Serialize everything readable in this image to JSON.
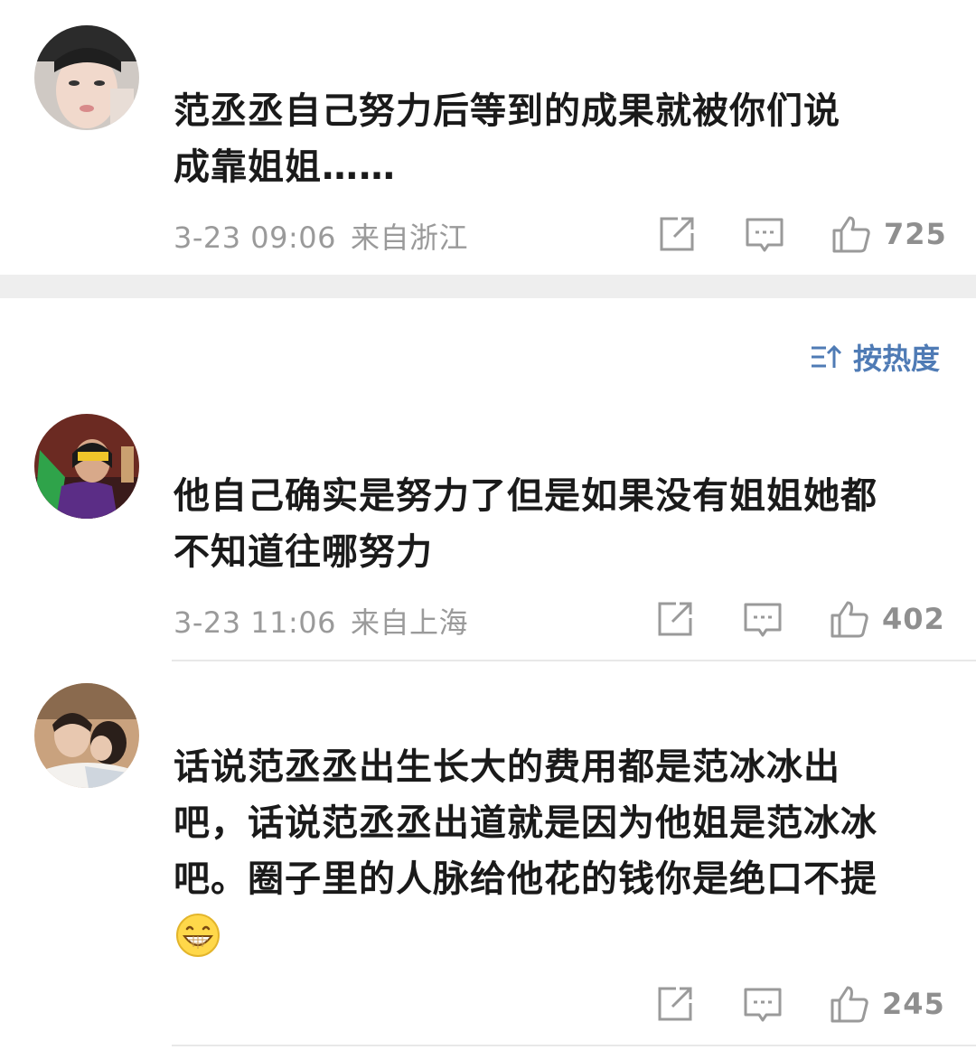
{
  "comments": [
    {
      "text": "范丞丞自己努力后等到的成果就被你们说\n成靠姐姐……",
      "time": "3-23 09:06",
      "location": "来自浙江",
      "likes": "725"
    },
    {
      "text": "他自己确实是努力了但是如果没有姐姐她都\n不知道往哪努力",
      "time": "3-23 11:06",
      "location": "来自上海",
      "likes": "402"
    },
    {
      "text": "话说范丞丞出生长大的费用都是范冰冰出\n吧，话说范丞丞出道就是因为他姐是范冰冰\n吧。圈子里的人脉给他花的钱你是绝口不提",
      "time": "",
      "location": "",
      "likes": "245"
    }
  ],
  "sort": {
    "label": "按热度"
  },
  "icons": {
    "share": "share-icon",
    "comment": "comment-icon",
    "like": "thumbs-up-icon",
    "sort": "sort-icon",
    "emoji": "grin-emoji"
  },
  "colors": {
    "accent": "#4f7bb5",
    "meta": "#9a9a9a",
    "band": "#eeeeee"
  }
}
